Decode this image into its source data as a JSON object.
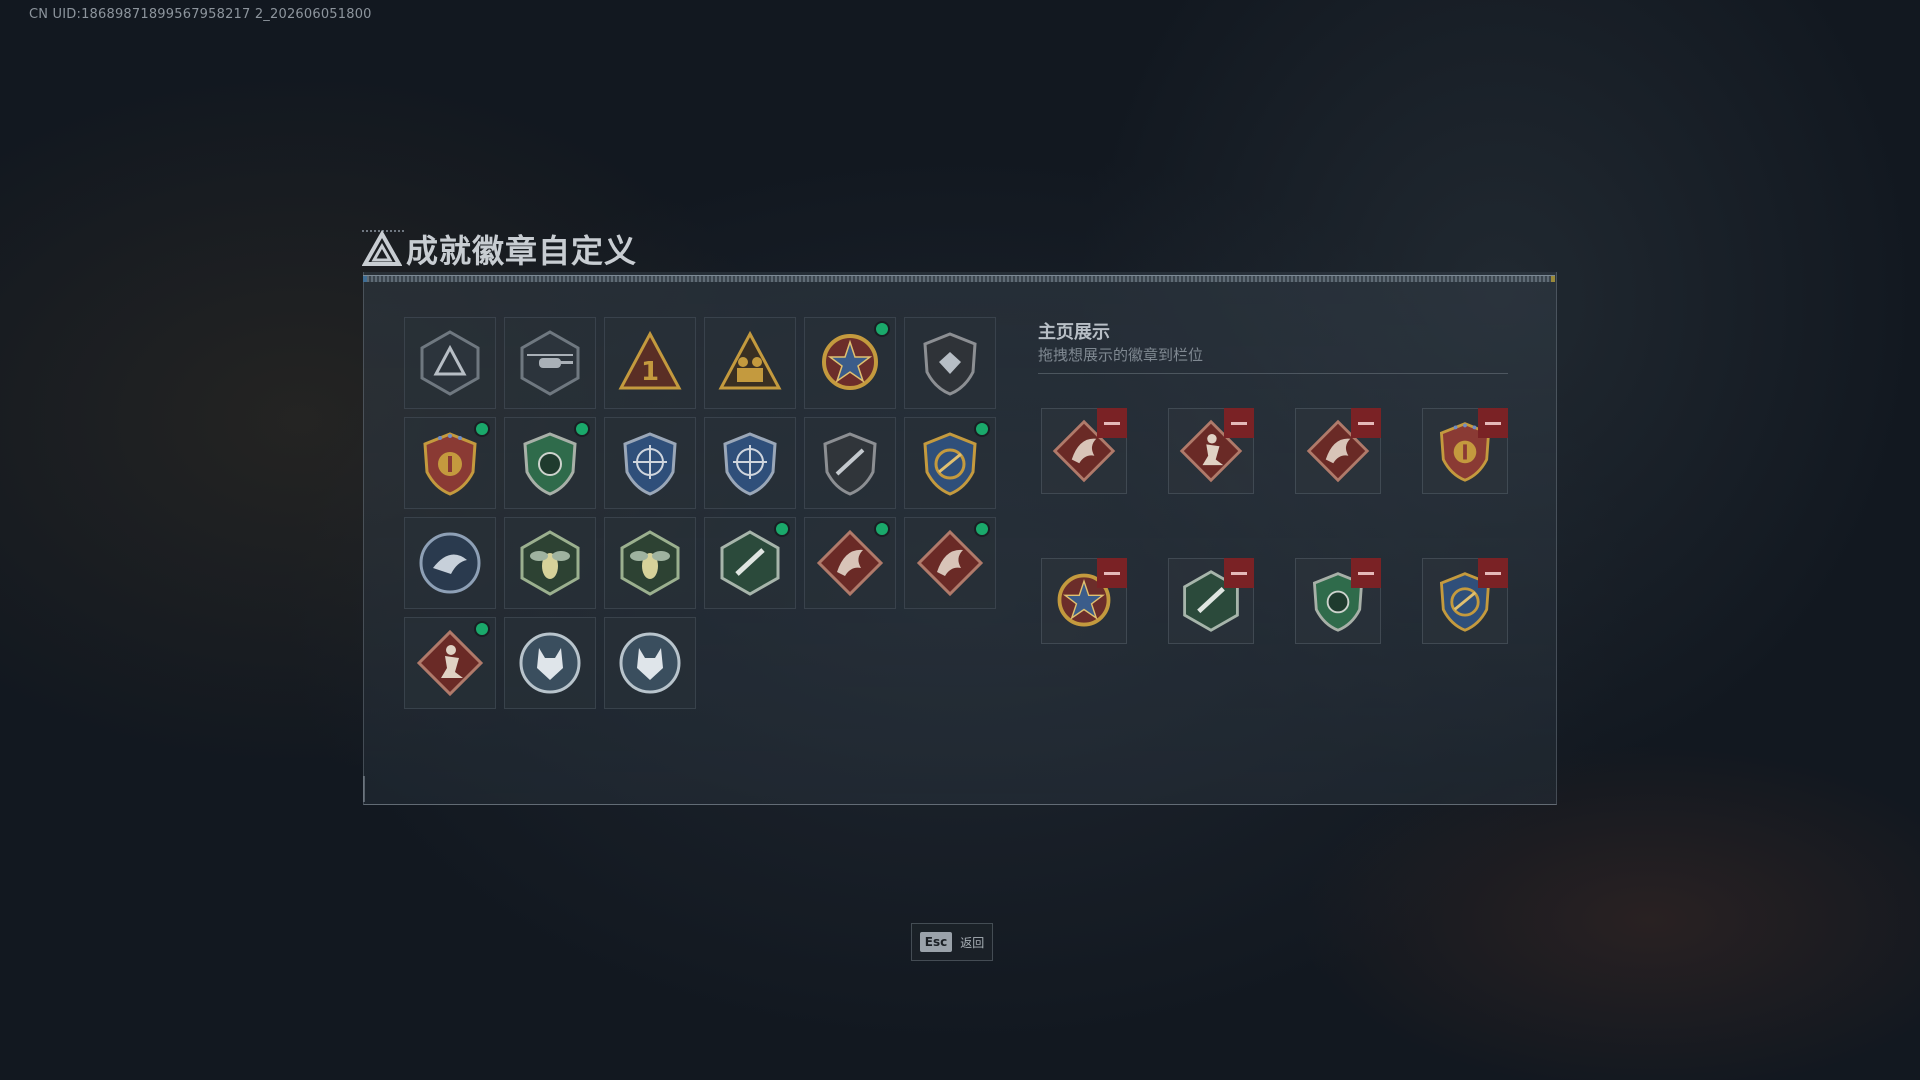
{
  "uid_text": "CN UID:18689871899567958217 2_202606051800",
  "title": "成就徽章自定义",
  "side": {
    "title": "主页展示",
    "subtitle": "拖拽想展示的徽章到栏位"
  },
  "footer": {
    "key": "Esc",
    "label": "返回"
  },
  "colors": {
    "new_dot": "#1aa96b",
    "remove": "#7a2225",
    "gold": "#c49a3e",
    "red_shield": "#8a3a34",
    "green_shield": "#2f6b4b",
    "blue_shield": "#2f4f7a"
  },
  "badges": [
    {
      "icon": "triangle-emblem-icon",
      "new": false
    },
    {
      "icon": "helicopter-emblem-icon",
      "new": false
    },
    {
      "icon": "number-one-emblem-icon",
      "new": false
    },
    {
      "icon": "soldiers-emblem-icon",
      "new": false
    },
    {
      "icon": "star-medal-icon",
      "new": true
    },
    {
      "icon": "shield-emblem-icon",
      "new": false
    },
    {
      "icon": "gold-laurel-badge-icon",
      "new": true
    },
    {
      "icon": "green-eagle-shield-icon",
      "new": true
    },
    {
      "icon": "crosshair-rifle-shield-icon",
      "new": false
    },
    {
      "icon": "crosshair-rifle-shield-icon",
      "new": false
    },
    {
      "icon": "rifle-emblem-icon",
      "new": false
    },
    {
      "icon": "gold-rifle-wreath-icon",
      "new": true
    },
    {
      "icon": "eagle-emblem-icon",
      "new": false
    },
    {
      "icon": "hornet-emblem-icon",
      "new": false
    },
    {
      "icon": "hornet-emblem-icon",
      "new": false
    },
    {
      "icon": "green-rifle-emblem-icon",
      "new": true
    },
    {
      "icon": "red-dragon-emblem-icon",
      "new": true
    },
    {
      "icon": "red-dragon-emblem-icon",
      "new": true
    },
    {
      "icon": "soldier-kneel-emblem-icon",
      "new": true
    },
    {
      "icon": "wolf-emblem-icon",
      "new": false
    },
    {
      "icon": "wolf-emblem-icon",
      "new": false
    }
  ],
  "showcase": [
    {
      "icon": "red-dragon-emblem-icon"
    },
    {
      "icon": "soldier-kneel-emblem-icon"
    },
    {
      "icon": "red-dragon-emblem-icon"
    },
    {
      "icon": "gold-laurel-badge-icon"
    },
    {
      "icon": "star-medal-icon"
    },
    {
      "icon": "green-rifle-emblem-icon"
    },
    {
      "icon": "green-eagle-shield-icon"
    },
    {
      "icon": "gold-rifle-wreath-icon"
    }
  ]
}
